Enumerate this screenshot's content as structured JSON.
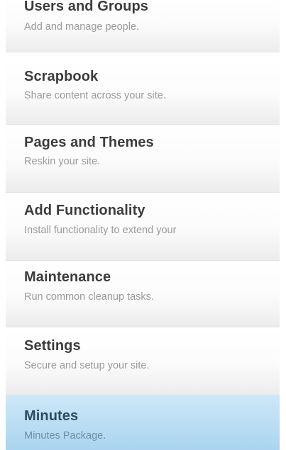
{
  "menu": {
    "items": [
      {
        "title": "Users and Groups",
        "description": "Add and manage people."
      },
      {
        "title": "Scrapbook",
        "description": "Share content across your site."
      },
      {
        "title": "Pages and Themes",
        "description": "Reskin your site."
      },
      {
        "title": "Add Functionality",
        "description": "Install functionality to extend your"
      },
      {
        "title": "Maintenance",
        "description": "Run common cleanup tasks."
      },
      {
        "title": "Settings",
        "description": "Secure and setup your site."
      },
      {
        "title": "Minutes",
        "description": "Minutes Package."
      }
    ],
    "active_item": "Minutes",
    "colors": {
      "title": "#3c3c3c",
      "description": "#9a9a9a",
      "active_background": "#b8dcf3"
    }
  }
}
